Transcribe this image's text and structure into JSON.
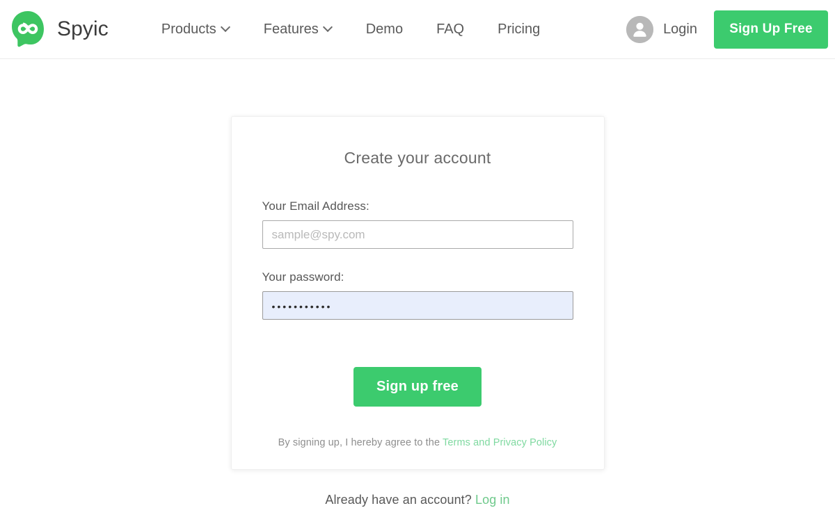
{
  "header": {
    "brand": {
      "name": "Spyic",
      "logo_icon": "infinity-logo-icon",
      "logo_color": "#3dc561"
    },
    "nav": [
      {
        "label": "Products",
        "has_dropdown": true,
        "icon": "chevron-down-icon"
      },
      {
        "label": "Features",
        "has_dropdown": true,
        "icon": "chevron-down-icon"
      },
      {
        "label": "Demo",
        "has_dropdown": false,
        "icon": ""
      },
      {
        "label": "FAQ",
        "has_dropdown": false,
        "icon": ""
      },
      {
        "label": "Pricing",
        "has_dropdown": false,
        "icon": ""
      }
    ],
    "login": {
      "label": "Login",
      "icon": "user-avatar-icon",
      "avatar_color": "#b8b8b8"
    },
    "signup_button": {
      "label": "Sign Up Free",
      "color": "#3ccb6e",
      "text_color": "#ffffff"
    }
  },
  "card": {
    "title": "Create your account",
    "email_field": {
      "label": "Your Email Address:",
      "placeholder": "sample@spy.com",
      "value": ""
    },
    "password_field": {
      "label": "Your password:",
      "placeholder": "",
      "value": "•••••••••••",
      "masked": true,
      "autofill_background": "#e8eefc"
    },
    "submit_button": {
      "label": "Sign up free",
      "color": "#3ccb6e"
    },
    "terms": {
      "text": "By signing up, I hereby agree to the",
      "link_label": "Terms and Privacy Policy",
      "link_color": "#7fd9a0"
    }
  },
  "footer": {
    "prompt_text": "Already have an account?",
    "login_link_label": "Log in",
    "link_color": "#6ec98b"
  }
}
